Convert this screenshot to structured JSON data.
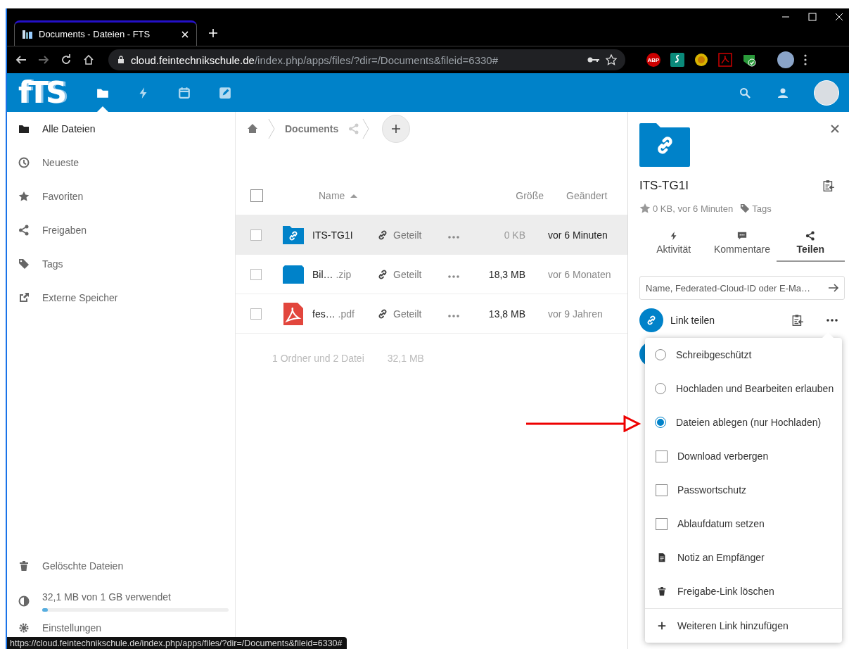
{
  "browser": {
    "tab_title": "Documents - Dateien - FTS",
    "url_host": "cloud.feintechnikschule.de",
    "url_path": "/index.php/apps/files/?dir=/Documents&fileid=6330#",
    "extensions": [
      {
        "kind": "abp",
        "label": "ABP"
      },
      {
        "kind": "s"
      },
      {
        "kind": "badge"
      },
      {
        "kind": "pdf"
      },
      {
        "kind": "check"
      }
    ]
  },
  "header": {
    "logo": "fTS",
    "apps": [
      {
        "kind": "files",
        "selected": true
      },
      {
        "kind": "activity",
        "selected": false
      },
      {
        "kind": "calendar",
        "selected": false
      },
      {
        "kind": "notes",
        "selected": false
      }
    ]
  },
  "sidebar": {
    "items": [
      {
        "kind": "folder",
        "label": "Alle Dateien",
        "selected": true
      },
      {
        "kind": "clock",
        "label": "Neueste",
        "selected": false
      },
      {
        "kind": "star",
        "label": "Favoriten",
        "selected": false
      },
      {
        "kind": "share",
        "label": "Freigaben",
        "selected": false
      },
      {
        "kind": "tag",
        "label": "Tags",
        "selected": false
      },
      {
        "kind": "external",
        "label": "Externe Speicher",
        "selected": false
      }
    ],
    "bottom": [
      {
        "kind": "trash",
        "label": "Gelöschte Dateien"
      }
    ],
    "quota": {
      "text": "32,1 MB von 1 GB verwendet",
      "level": 0.03
    },
    "settings": "Einstellungen"
  },
  "breadcrumb": {
    "folder": "Documents"
  },
  "table": {
    "select_all": {
      "checked": false
    },
    "columns": [
      "Name",
      "Größe",
      "Geändert"
    ],
    "rows": [
      {
        "kind": "folder",
        "name": "ITS-TG1I",
        "ext": "",
        "share": "Geteilt",
        "size": "0 KB",
        "modified": "vor 6 Minuten",
        "selected": true
      },
      {
        "kind": "archive",
        "name": "Bil…",
        "ext": ".zip",
        "share": "Geteilt",
        "size": "18,3 MB",
        "modified": "vor 6 Monaten",
        "selected": false
      },
      {
        "kind": "pdf",
        "name": "fes…",
        "ext": ".pdf",
        "share": "Geteilt",
        "size": "13,8 MB",
        "modified": "vor 9 Jahren",
        "selected": false
      }
    ],
    "summary": {
      "count": "1 Ordner und 2 Datei",
      "size": "32,1 MB"
    }
  },
  "details": {
    "title": "ITS-TG1I",
    "meta": "0 KB, vor 6 Minuten",
    "tags": "Tags",
    "tabs": [
      {
        "kind": "activity",
        "label": "Aktivität",
        "selected": false
      },
      {
        "kind": "comments",
        "label": "Kommentare",
        "selected": false
      },
      {
        "kind": "share",
        "label": "Teilen",
        "selected": true
      }
    ],
    "share_input": {
      "placeholder": "Name, Federated-Cloud-ID oder E-Ma…"
    },
    "link_share": {
      "label": "Link teilen"
    }
  },
  "share_menu": [
    {
      "kind": "radio",
      "label": "Schreibgeschützt",
      "selected": false
    },
    {
      "kind": "radio",
      "label": "Hochladen und Bearbeiten erlauben",
      "selected": false
    },
    {
      "kind": "radio",
      "label": "Dateien ablegen (nur Hochladen)",
      "selected": true
    },
    {
      "kind": "checkbox",
      "label": "Download verbergen",
      "checked": false
    },
    {
      "kind": "checkbox",
      "label": "Passwortschutz",
      "checked": false
    },
    {
      "kind": "checkbox",
      "label": "Ablaufdatum setzen",
      "checked": false
    },
    {
      "kind": "note",
      "label": "Notiz an Empfänger"
    },
    {
      "kind": "delete",
      "label": "Freigabe-Link löschen"
    },
    {
      "kind": "add",
      "label": "Weiteren Link hinzufügen"
    }
  ],
  "status_url": "https://cloud.feintechnikschule.de/index.php/apps/files/?dir=/Documents&fileid=6330#"
}
